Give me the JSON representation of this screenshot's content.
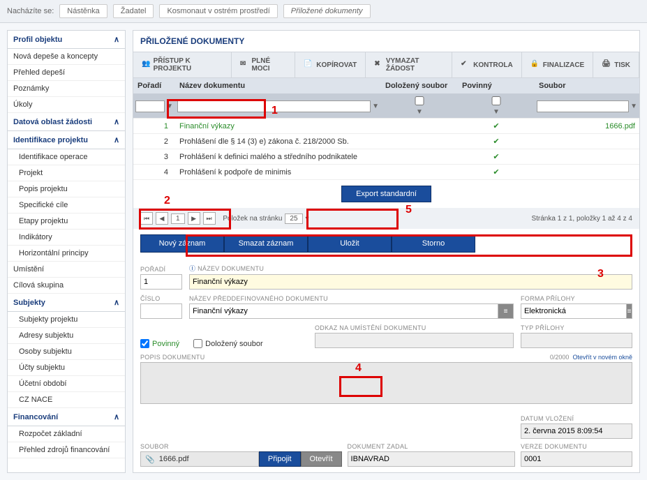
{
  "breadcrumb": {
    "label": "Nacházíte se:",
    "items": [
      "Nástěnka",
      "Žadatel",
      "Kosmonaut v ostrém prostředí",
      "Přiložené dokumenty"
    ]
  },
  "sidebar": {
    "groups": [
      {
        "title": "Profil objektu",
        "items": [
          "Nová depeše a koncepty",
          "Přehled depeší",
          "Poznámky",
          "Úkoly"
        ]
      },
      {
        "title": "Datová oblast žádosti",
        "items": []
      },
      {
        "title": "Identifikace projektu",
        "items": [
          "Identifikace operace",
          "Projekt",
          "Popis projektu",
          "Specifické cíle",
          "Etapy projektu",
          "Indikátory",
          "Horizontální principy"
        ]
      }
    ],
    "loose": [
      "Umístění",
      "Cílová skupina"
    ],
    "groups2": [
      {
        "title": "Subjekty",
        "items": [
          "Subjekty projektu",
          "Adresy subjektu",
          "Osoby subjektu",
          "Účty subjektu",
          "Účetní období",
          "CZ NACE"
        ]
      },
      {
        "title": "Financování",
        "items": [
          "Rozpočet základní",
          "Přehled zdrojů financování"
        ]
      }
    ]
  },
  "panel": {
    "title": "PŘILOŽENÉ DOKUMENTY"
  },
  "toolbar": {
    "items": [
      {
        "icon": "people",
        "label": "PŘÍSTUP K PROJEKTU"
      },
      {
        "icon": "mail",
        "label": "PLNÉ MOCI"
      },
      {
        "icon": "copy",
        "label": "KOPÍROVAT"
      },
      {
        "icon": "x",
        "label": "VYMAZAT ŽÁDOST"
      },
      {
        "icon": "check",
        "label": "KONTROLA"
      },
      {
        "icon": "lock",
        "label": "FINALIZACE"
      },
      {
        "icon": "print",
        "label": "TISK"
      }
    ]
  },
  "grid": {
    "headers": [
      "Pořadí",
      "Název dokumentu",
      "Doložený soubor",
      "Povinný",
      "Soubor"
    ],
    "rows": [
      {
        "n": "1",
        "name": "Finanční výkazy",
        "dol": false,
        "pov": true,
        "file": "1666.pdf",
        "active": true
      },
      {
        "n": "2",
        "name": "Prohlášení dle § 14 (3) e) zákona č. 218/2000 Sb.",
        "dol": false,
        "pov": true,
        "file": ""
      },
      {
        "n": "3",
        "name": "Prohlášení k definici malého a středního podnikatele",
        "dol": false,
        "pov": true,
        "file": ""
      },
      {
        "n": "4",
        "name": "Prohlášení k podpoře de minimis",
        "dol": false,
        "pov": true,
        "file": ""
      }
    ],
    "export": "Export standardní"
  },
  "pager": {
    "pageLabel": "Položek na stránku",
    "pageSize": "25",
    "info": "Stránka 1 z 1, položky 1 až 4 z 4",
    "buttons": {
      "first": "⏮",
      "prev": "◀",
      "page": "1",
      "next": "▶",
      "last": "⏭"
    }
  },
  "actions": {
    "new": "Nový záznam",
    "delete": "Smazat záznam",
    "save": "Uložit",
    "cancel": "Storno"
  },
  "form": {
    "poradi": {
      "label": "POŘADÍ",
      "value": "1"
    },
    "nazev": {
      "label": "NÁZEV DOKUMENTU",
      "value": "Finanční výkazy"
    },
    "cislo": {
      "label": "ČÍSLO",
      "value": ""
    },
    "preddef": {
      "label": "NÁZEV PŘEDDEFINOVANÉHO DOKUMENTU",
      "value": "Finanční výkazy"
    },
    "forma": {
      "label": "FORMA PŘÍLOHY",
      "value": "Elektronická"
    },
    "typ": {
      "label": "TYP PŘÍLOHY",
      "value": ""
    },
    "odkaz": {
      "label": "ODKAZ NA UMÍSTĚNÍ DOKUMENTU",
      "value": ""
    },
    "povinny": "Povinný",
    "dolozeny": "Doložený soubor",
    "popis": {
      "label": "POPIS DOKUMENTU",
      "count": "0/2000",
      "open": "Otevřít v novém okně"
    },
    "soubor": {
      "label": "SOUBOR",
      "value": "1666.pdf",
      "attach": "Připojit",
      "open": "Otevřít"
    },
    "zadal": {
      "label": "DOKUMENT ZADAL",
      "value": "IBNAVRAD"
    },
    "datum": {
      "label": "DATUM VLOŽENÍ",
      "value": "2. června 2015 8:09:54"
    },
    "verze": {
      "label": "VERZE DOKUMENTU",
      "value": "0001"
    }
  },
  "annotations": {
    "1": "1",
    "2": "2",
    "3": "3",
    "4": "4",
    "5": "5"
  }
}
